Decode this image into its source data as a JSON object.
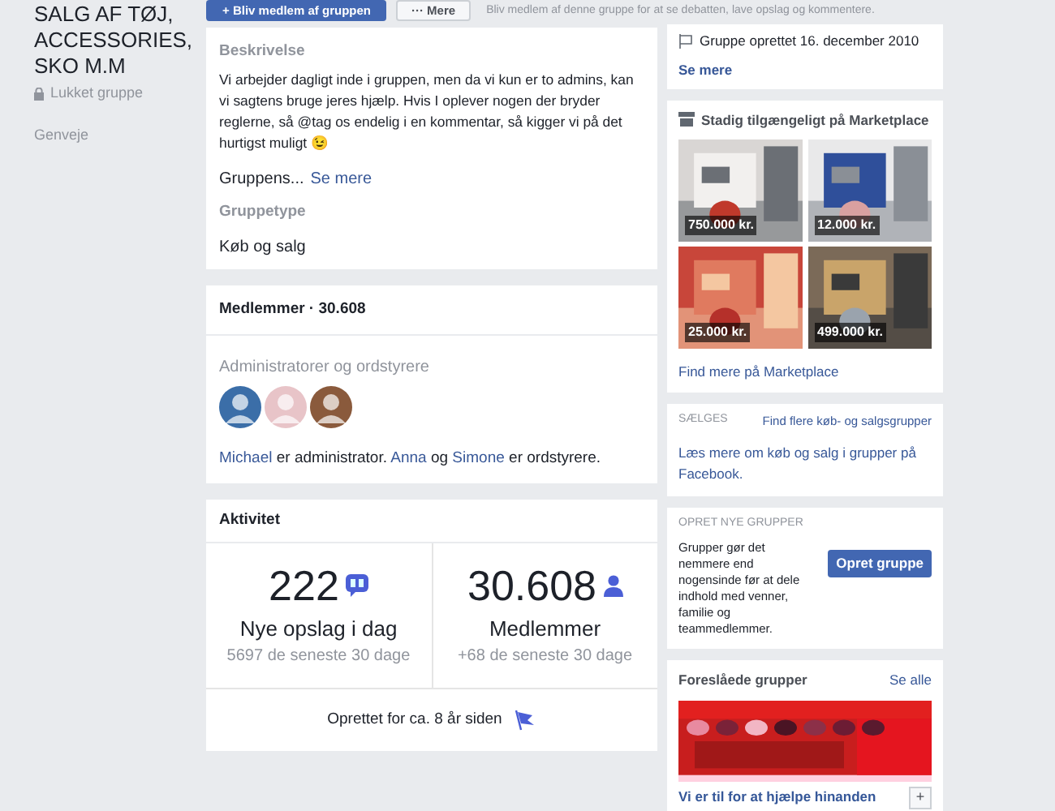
{
  "group": {
    "title": "SALG AF TØJ, ACCESSORIES, SKO M.M",
    "privacy": "Lukket gruppe",
    "shortcuts": "Genveje"
  },
  "actions": {
    "join": "+ Bliv medlem af gruppen",
    "more": "··· Mere",
    "hint": "Bliv medlem af denne gruppe for at se debatten, lave opslag og kommentere."
  },
  "about": {
    "heading": "Beskrivelse",
    "text": "Vi arbejder dagligt inde i gruppen, men da vi kun er to admins, kan vi sagtens bruge jeres hjælp. Hvis I oplever nogen der bryder reglerne, så @tag os endelig i en kommentar, så kigger vi på det hurtigst muligt 😉",
    "rules": "Gruppens...",
    "see_more": "Se mere",
    "type_heading": "Gruppetype",
    "type": "Køb og salg"
  },
  "members": {
    "heading": "Medlemmer · 30.608",
    "admins_heading": "Administratorer og ordstyrere",
    "avatars": [
      {
        "color": "#3b6ea8"
      },
      {
        "color": "#e8c4c8"
      },
      {
        "color": "#8a5a3c"
      }
    ],
    "admin_name": "Michael",
    "admin_text": "er administrator.",
    "mod1": "Anna",
    "and": "og",
    "mod2": "Simone",
    "mod_text": "er ordstyrere."
  },
  "activity": {
    "heading": "Aktivitet",
    "stats": [
      {
        "kind": "posts",
        "value": "222",
        "label": "Nye opslag i dag",
        "sub": "5697 de seneste 30 dage"
      },
      {
        "kind": "members",
        "value": "30.608",
        "label": "Medlemmer",
        "sub": "+68 de seneste 30 dage"
      }
    ],
    "created": "Oprettet for ca. 8 år siden"
  },
  "info": {
    "created": "Gruppe oprettet 16. december 2010",
    "see_more": "Se mere"
  },
  "marketplace": {
    "heading": "Stadig tilgængeligt på Marketplace",
    "items": [
      {
        "price": "750.000 kr."
      },
      {
        "price": "12.000 kr."
      },
      {
        "price": "25.000 kr."
      },
      {
        "price": "499.000 kr."
      }
    ],
    "link": "Find mere på Marketplace"
  },
  "selling": {
    "heading": "SÆLGES",
    "link": "Find flere køb- og salgsgrupper",
    "text": "Læs mere om køb og salg i grupper på Facebook."
  },
  "create": {
    "heading": "OPRET NYE GRUPPER",
    "text": "Grupper gør det nemmere end nogensinde før at dele indhold med venner, familie og teammedlemmer.",
    "button": "Opret gruppe"
  },
  "suggested": {
    "heading": "Foreslåede grupper",
    "see_all": "Se alle",
    "groups": [
      {
        "name": "Vi er til for at hjælpe hinanden",
        "add": "+"
      }
    ]
  }
}
